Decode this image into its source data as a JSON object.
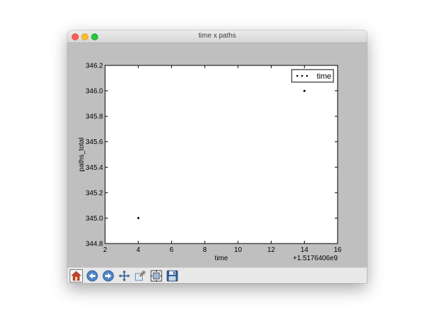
{
  "window": {
    "title": "time x paths"
  },
  "toolbar": {
    "buttons": [
      {
        "name": "home",
        "icon": "home-icon"
      },
      {
        "name": "back",
        "icon": "back-arrow-icon"
      },
      {
        "name": "forward",
        "icon": "forward-arrow-icon"
      },
      {
        "name": "pan",
        "icon": "pan-move-icon"
      },
      {
        "name": "zoom",
        "icon": "zoom-rect-icon"
      },
      {
        "name": "subplots",
        "icon": "subplots-config-icon"
      },
      {
        "name": "save",
        "icon": "save-floppy-icon"
      }
    ]
  },
  "chart_data": {
    "type": "scatter",
    "xlabel": "time",
    "ylabel": "paths_total",
    "x_offset_label": "+1.5176406e9",
    "xlim": [
      2,
      16
    ],
    "ylim": [
      344.8,
      346.2
    ],
    "x_ticks": [
      "2",
      "4",
      "6",
      "8",
      "10",
      "12",
      "14",
      "16"
    ],
    "y_ticks": [
      "344.8",
      "345.0",
      "345.2",
      "345.4",
      "345.6",
      "345.8",
      "346.0",
      "346.2"
    ],
    "legend": {
      "position": "top-right",
      "entries": [
        "time"
      ]
    },
    "grid": false,
    "series": [
      {
        "name": "time",
        "color": "#000000",
        "points": [
          [
            4,
            345.0
          ],
          [
            14,
            346.0
          ]
        ]
      }
    ]
  }
}
